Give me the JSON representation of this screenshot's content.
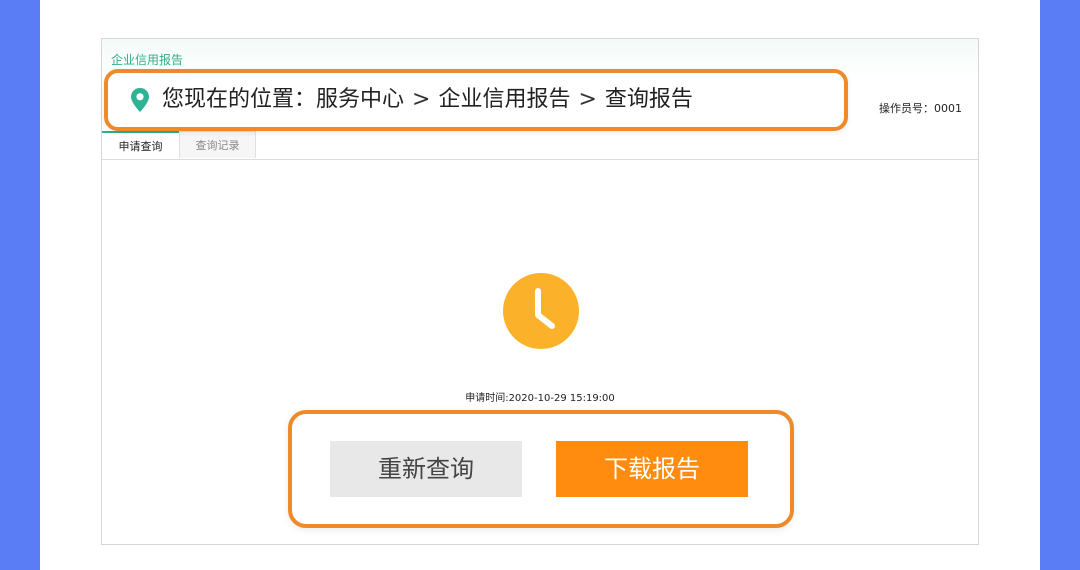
{
  "panel": {
    "title": "企业信用报告"
  },
  "operator": {
    "label": "操作员号",
    "value": "0001"
  },
  "tabs": [
    {
      "label": "申请查询"
    },
    {
      "label": "查询记录"
    }
  ],
  "breadcrumb": {
    "prefix": "您现在的位置：",
    "items": [
      "服务中心",
      "企业信用报告",
      "查询报告"
    ],
    "separator": ">"
  },
  "status": {
    "apply_time": "申请时间:2020-10-29 15:19:00"
  },
  "buttons": {
    "requery": "重新查询",
    "download": "下载报告"
  },
  "colors": {
    "accent_blue": "#5a7cf5",
    "highlight_orange": "#ee8a2a",
    "button_orange": "#ff8c0f",
    "clock_yellow": "#fbb12a",
    "brand_green": "#2fae8a"
  }
}
